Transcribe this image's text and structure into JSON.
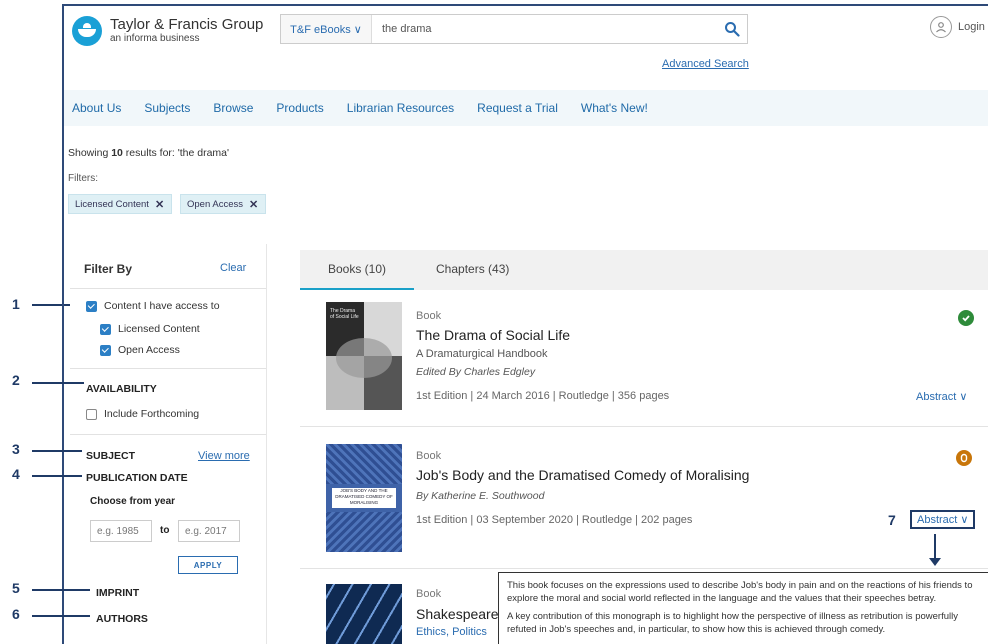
{
  "header": {
    "logo_title": "Taylor & Francis Group",
    "logo_sub": "an informa business",
    "search_scope": "T&F eBooks ∨",
    "search_value": "the drama",
    "advanced_search": "Advanced Search",
    "login": "Login"
  },
  "nav": [
    "About Us",
    "Subjects",
    "Browse",
    "Products",
    "Librarian Resources",
    "Request a Trial",
    "What's New!"
  ],
  "results_summary": {
    "prefix": "Showing ",
    "count": "10",
    "suffix": " results for: 'the drama'"
  },
  "filters_label": "Filters:",
  "chips": [
    {
      "label": "Licensed Content",
      "x": "✕"
    },
    {
      "label": "Open Access",
      "x": "✕"
    }
  ],
  "sidebar": {
    "title": "Filter By",
    "clear": "Clear",
    "content_access": "Content I have access to",
    "licensed": "Licensed Content",
    "open_access": "Open Access",
    "availability": "AVAILABILITY",
    "include_forthcoming": "Include Forthcoming",
    "subject": "SUBJECT",
    "view_more": "View more",
    "pub_date": "PUBLICATION DATE",
    "choose_year": "Choose from year",
    "from_placeholder": "e.g. 1985",
    "to": "to",
    "to_placeholder": "e.g. 2017",
    "apply": "APPLY",
    "imprint": "IMPRINT",
    "authors": "AUTHORS"
  },
  "tabs": [
    {
      "label": "Books (10)",
      "active": true
    },
    {
      "label": "Chapters (43)",
      "active": false
    }
  ],
  "results": [
    {
      "type": "Book",
      "title": "The Drama of Social Life",
      "subtitle": "A Dramaturgical Handbook",
      "author": "Edited By Charles Edgley",
      "meta": "1st Edition | 24 March 2016 | Routledge | 356 pages",
      "abstract": "Abstract ∨",
      "status_color": "#2e8b3a",
      "cover_text": "The Drama of Social Life"
    },
    {
      "type": "Book",
      "title": "Job's Body and the Dramatised Comedy of Moralising",
      "author": "By Katherine E. Southwood",
      "meta": "1st Edition | 03 September 2020 | Routledge | 202 pages",
      "abstract": "Abstract ∨",
      "status_color": "#c8760a",
      "cover_text": "JOB'S BODY AND THE DRAMATISED COMEDY OF MORALISING"
    },
    {
      "type": "Book",
      "title": "Shakespeare",
      "subtitle": "Ethics, Politics"
    }
  ],
  "abstract_popup": {
    "p1": "This book focuses on the expressions used to describe Job's body in pain and on the reactions of his friends to explore the moral and social world reflected in the language and the values that their speeches betray.",
    "p2": "A key contribution of this monograph is to highlight how the perspective of illness as retribution is powerfully refuted in Job's speeches and, in particular, to show how this is achieved through comedy."
  },
  "annotations": [
    "1",
    "2",
    "3",
    "4",
    "5",
    "6",
    "7"
  ]
}
